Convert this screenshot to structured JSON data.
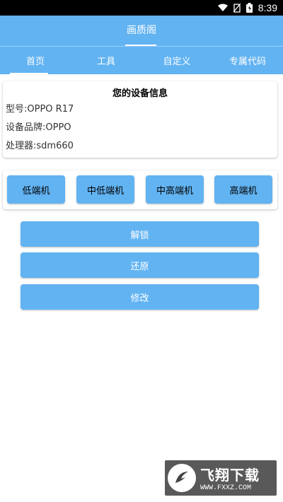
{
  "status_bar": {
    "time": "8:39",
    "icons": [
      "wifi-icon",
      "no-sim-icon",
      "battery-icon"
    ]
  },
  "app": {
    "title": "画质阁"
  },
  "tabs": [
    {
      "label": "首页",
      "active": true
    },
    {
      "label": "工具",
      "active": false
    },
    {
      "label": "自定义",
      "active": false
    },
    {
      "label": "专属代码",
      "active": false
    }
  ],
  "device_info": {
    "heading": "您的设备信息",
    "model": "型号:OPPO R17",
    "brand": "设备品牌:OPPO",
    "processor": "处理器:sdm660"
  },
  "device_tiers": [
    "低端机",
    "中低端机",
    "中高端机",
    "高端机"
  ],
  "actions": {
    "unlock": "解锁",
    "restore": "还原",
    "modify": "修改"
  },
  "watermark": {
    "brand": "飞翔下载",
    "url": "WWW.FXXZ.COM"
  },
  "colors": {
    "primary": "#62b3f2",
    "status_bar": "#000000",
    "background": "#ffffff"
  }
}
